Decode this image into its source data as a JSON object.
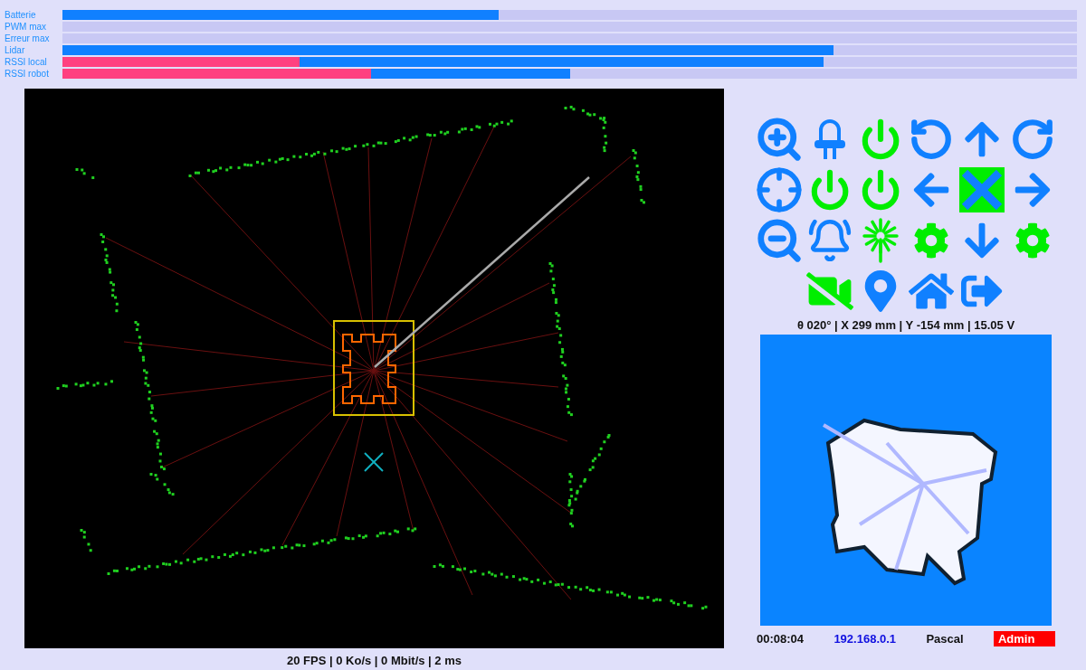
{
  "gauges": [
    {
      "label": "Batterie",
      "level": 0.43
    },
    {
      "label": "PWM max"
    },
    {
      "label": "Erreur max"
    },
    {
      "label": "Lidar",
      "level": 0.76
    },
    {
      "label": "RSSI local",
      "level": 0.75,
      "floor": {
        "level": 0.234
      }
    },
    {
      "label": "RSSI robot",
      "level": 0.5,
      "floor": {
        "level": 0.304
      }
    }
  ],
  "controls": [
    [
      {
        "kind": "zoom-in",
        "on": false
      },
      {
        "kind": "led",
        "on": false
      },
      {
        "kind": "power",
        "on": true
      },
      {
        "kind": "rotate-left",
        "on": false
      },
      {
        "kind": "up",
        "on": false
      },
      {
        "kind": "rotate-right",
        "on": false
      }
    ],
    [
      {
        "kind": "target",
        "on": false
      },
      {
        "kind": "power",
        "on": true
      },
      {
        "kind": "power",
        "on": true
      },
      {
        "kind": "left",
        "on": false
      },
      {
        "kind": "stop",
        "on": true
      },
      {
        "kind": "right",
        "on": false
      }
    ],
    [
      {
        "kind": "zoom-out",
        "on": false
      },
      {
        "kind": "alarm",
        "on": false
      },
      {
        "kind": "laser",
        "on": true
      },
      {
        "kind": "gear",
        "on": true
      },
      {
        "kind": "down",
        "on": false
      },
      {
        "kind": "gear",
        "on": true
      }
    ],
    [
      {
        "kind": "camera-off",
        "on": true
      },
      {
        "kind": "pin",
        "on": false
      },
      {
        "kind": "home",
        "on": false
      },
      {
        "kind": "exit",
        "on": false
      }
    ]
  ],
  "pose": "θ 020° | X 299 mm | Y -154 mm | 15.05 V",
  "stats": "20 FPS | 0 Ko/s | 0 Mbit/s | 2 ms",
  "footer": {
    "uptime": "00:08:04",
    "ip": "192.168.0.1",
    "user": "Pascal",
    "role": "Admin"
  }
}
